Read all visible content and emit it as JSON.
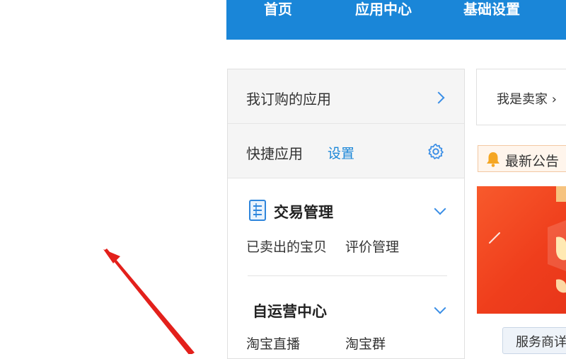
{
  "topnav": {
    "items": [
      "首页",
      "应用中心",
      "基础设置"
    ]
  },
  "sidebar": {
    "my_apps_label": "我订购的应用",
    "quick_apps_label": "快捷应用",
    "quick_apps_settings": "设置",
    "sections": [
      {
        "title": "交易管理",
        "links": [
          "已卖出的宝贝",
          "评价管理"
        ]
      },
      {
        "title": "自运营中心",
        "links": [
          "淘宝直播",
          "淘宝群"
        ]
      }
    ]
  },
  "right_panel": {
    "breadcrumb": "我是卖家 ›",
    "notice": "最新公告",
    "tag": "服务商详"
  },
  "colors": {
    "brand_blue": "#1a86d8",
    "accent_red": "#e3201b",
    "banner_orange": "#f25228"
  }
}
